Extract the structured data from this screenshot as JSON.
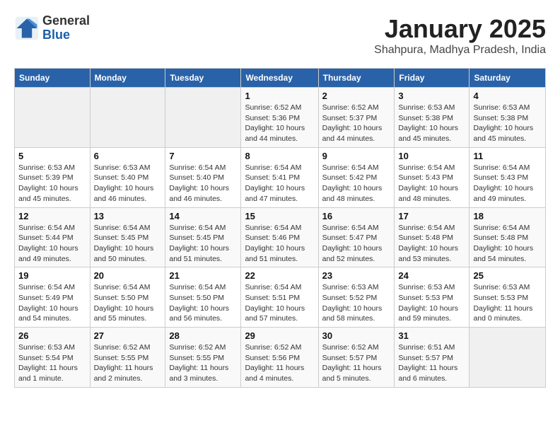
{
  "header": {
    "logo_general": "General",
    "logo_blue": "Blue",
    "title": "January 2025",
    "subtitle": "Shahpura, Madhya Pradesh, India"
  },
  "days_of_week": [
    "Sunday",
    "Monday",
    "Tuesday",
    "Wednesday",
    "Thursday",
    "Friday",
    "Saturday"
  ],
  "weeks": [
    [
      {
        "day": "",
        "info": ""
      },
      {
        "day": "",
        "info": ""
      },
      {
        "day": "",
        "info": ""
      },
      {
        "day": "1",
        "info": "Sunrise: 6:52 AM\nSunset: 5:36 PM\nDaylight: 10 hours and 44 minutes."
      },
      {
        "day": "2",
        "info": "Sunrise: 6:52 AM\nSunset: 5:37 PM\nDaylight: 10 hours and 44 minutes."
      },
      {
        "day": "3",
        "info": "Sunrise: 6:53 AM\nSunset: 5:38 PM\nDaylight: 10 hours and 45 minutes."
      },
      {
        "day": "4",
        "info": "Sunrise: 6:53 AM\nSunset: 5:38 PM\nDaylight: 10 hours and 45 minutes."
      }
    ],
    [
      {
        "day": "5",
        "info": "Sunrise: 6:53 AM\nSunset: 5:39 PM\nDaylight: 10 hours and 45 minutes."
      },
      {
        "day": "6",
        "info": "Sunrise: 6:53 AM\nSunset: 5:40 PM\nDaylight: 10 hours and 46 minutes."
      },
      {
        "day": "7",
        "info": "Sunrise: 6:54 AM\nSunset: 5:40 PM\nDaylight: 10 hours and 46 minutes."
      },
      {
        "day": "8",
        "info": "Sunrise: 6:54 AM\nSunset: 5:41 PM\nDaylight: 10 hours and 47 minutes."
      },
      {
        "day": "9",
        "info": "Sunrise: 6:54 AM\nSunset: 5:42 PM\nDaylight: 10 hours and 48 minutes."
      },
      {
        "day": "10",
        "info": "Sunrise: 6:54 AM\nSunset: 5:43 PM\nDaylight: 10 hours and 48 minutes."
      },
      {
        "day": "11",
        "info": "Sunrise: 6:54 AM\nSunset: 5:43 PM\nDaylight: 10 hours and 49 minutes."
      }
    ],
    [
      {
        "day": "12",
        "info": "Sunrise: 6:54 AM\nSunset: 5:44 PM\nDaylight: 10 hours and 49 minutes."
      },
      {
        "day": "13",
        "info": "Sunrise: 6:54 AM\nSunset: 5:45 PM\nDaylight: 10 hours and 50 minutes."
      },
      {
        "day": "14",
        "info": "Sunrise: 6:54 AM\nSunset: 5:45 PM\nDaylight: 10 hours and 51 minutes."
      },
      {
        "day": "15",
        "info": "Sunrise: 6:54 AM\nSunset: 5:46 PM\nDaylight: 10 hours and 51 minutes."
      },
      {
        "day": "16",
        "info": "Sunrise: 6:54 AM\nSunset: 5:47 PM\nDaylight: 10 hours and 52 minutes."
      },
      {
        "day": "17",
        "info": "Sunrise: 6:54 AM\nSunset: 5:48 PM\nDaylight: 10 hours and 53 minutes."
      },
      {
        "day": "18",
        "info": "Sunrise: 6:54 AM\nSunset: 5:48 PM\nDaylight: 10 hours and 54 minutes."
      }
    ],
    [
      {
        "day": "19",
        "info": "Sunrise: 6:54 AM\nSunset: 5:49 PM\nDaylight: 10 hours and 54 minutes."
      },
      {
        "day": "20",
        "info": "Sunrise: 6:54 AM\nSunset: 5:50 PM\nDaylight: 10 hours and 55 minutes."
      },
      {
        "day": "21",
        "info": "Sunrise: 6:54 AM\nSunset: 5:50 PM\nDaylight: 10 hours and 56 minutes."
      },
      {
        "day": "22",
        "info": "Sunrise: 6:54 AM\nSunset: 5:51 PM\nDaylight: 10 hours and 57 minutes."
      },
      {
        "day": "23",
        "info": "Sunrise: 6:53 AM\nSunset: 5:52 PM\nDaylight: 10 hours and 58 minutes."
      },
      {
        "day": "24",
        "info": "Sunrise: 6:53 AM\nSunset: 5:53 PM\nDaylight: 10 hours and 59 minutes."
      },
      {
        "day": "25",
        "info": "Sunrise: 6:53 AM\nSunset: 5:53 PM\nDaylight: 11 hours and 0 minutes."
      }
    ],
    [
      {
        "day": "26",
        "info": "Sunrise: 6:53 AM\nSunset: 5:54 PM\nDaylight: 11 hours and 1 minute."
      },
      {
        "day": "27",
        "info": "Sunrise: 6:52 AM\nSunset: 5:55 PM\nDaylight: 11 hours and 2 minutes."
      },
      {
        "day": "28",
        "info": "Sunrise: 6:52 AM\nSunset: 5:55 PM\nDaylight: 11 hours and 3 minutes."
      },
      {
        "day": "29",
        "info": "Sunrise: 6:52 AM\nSunset: 5:56 PM\nDaylight: 11 hours and 4 minutes."
      },
      {
        "day": "30",
        "info": "Sunrise: 6:52 AM\nSunset: 5:57 PM\nDaylight: 11 hours and 5 minutes."
      },
      {
        "day": "31",
        "info": "Sunrise: 6:51 AM\nSunset: 5:57 PM\nDaylight: 11 hours and 6 minutes."
      },
      {
        "day": "",
        "info": ""
      }
    ]
  ]
}
